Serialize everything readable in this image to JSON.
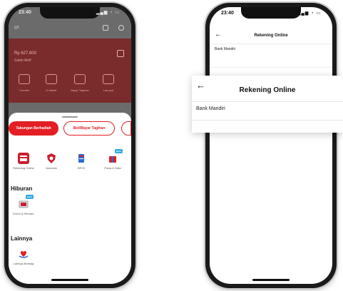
{
  "phone1": {
    "status_time": "23:40",
    "status_icons": "▂▄▆ ◔ ▭",
    "header_text": "ipt",
    "account_label": "Rp 627.800",
    "account_sub": "Saldo Aktif",
    "quick_actions": [
      "Transfer",
      "E-Wallet",
      "Bayar Tagihan",
      "Lainnya"
    ],
    "sheet": {
      "primary_button": "Tabungan Berhadiah",
      "secondary_button": "Beli/Bayar Tagihan"
    },
    "services": [
      {
        "label": "Rekening Online",
        "icon": "card-icon",
        "color": "#c8202f"
      },
      {
        "label": "Asuransi",
        "icon": "shield-icon",
        "color": "#c8202f"
      },
      {
        "label": "BPJS",
        "icon": "document-icon",
        "color": "#2a6bd0"
      },
      {
        "label": "Pulsa & Data",
        "icon": "gift-icon",
        "color": "#d8202a",
        "badge": "Baru"
      }
    ],
    "sections": {
      "hiburan": {
        "title": "Hiburan",
        "item": {
          "label": "Event & Hiburan",
          "icon": "ticket-icon",
          "badge": "Baru"
        }
      },
      "lainnya": {
        "title": "Lainnya",
        "item": {
          "label": "Lainnya Berbagi",
          "icon": "heart-hands-icon"
        }
      }
    }
  },
  "phone2": {
    "status_time": "23:40",
    "status_icons": "▂▄▆ ◔ ▭",
    "header_title": "Rekening Online",
    "row_label": "Bank Mandiri"
  },
  "zoom_card": {
    "title": "Rekening Online",
    "row_label": "Bank Mandiri"
  },
  "colors": {
    "brand_red": "#e31e24",
    "dim_overlay": "#6b6b6b",
    "badge_blue": "#2fa8e0"
  }
}
